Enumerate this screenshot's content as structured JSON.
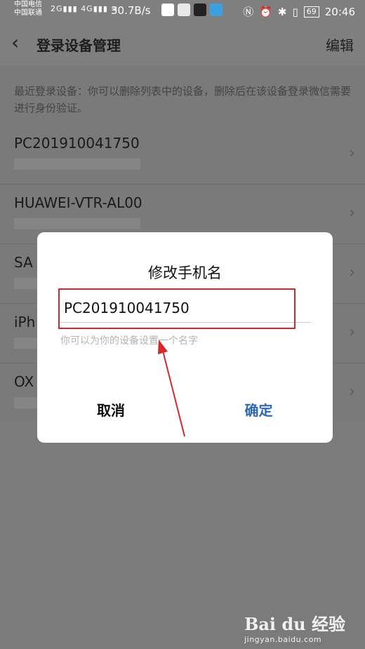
{
  "status": {
    "carrier1": "中国电信",
    "carrier2": "中国联通",
    "net1": "2G",
    "net2": "4G",
    "speed": "30.7B/s",
    "battery": "69",
    "time": "20:46",
    "icons": [
      "cloud-app-icon",
      "video-app-icon",
      "tiktok-icon",
      "paper-plane-icon",
      "nfc-icon",
      "alarm-icon",
      "bluetooth-icon",
      "vibrate-icon"
    ]
  },
  "header": {
    "back_icon": "chevron-left-icon",
    "title": "登录设备管理",
    "edit_label": "编辑"
  },
  "hint": "最近登录设备：你可以删除列表中的设备，删除后在该设备登录微信需要进行身份验证。",
  "devices": [
    {
      "name": "PC201910041750"
    },
    {
      "name": "HUAWEI-VTR-AL00"
    },
    {
      "name": "SA"
    },
    {
      "name": "iPh"
    },
    {
      "name": "OX"
    }
  ],
  "dialog": {
    "title": "修改手机名",
    "input_value": "PC201910041750",
    "hint": "你可以为你的设备设置一个名字",
    "cancel_label": "取消",
    "ok_label": "确定"
  },
  "colors": {
    "accent": "#2d67b8",
    "highlight": "#d5282a"
  },
  "watermark": {
    "main": "Bai du 经验",
    "sub": "jingyan.baidu.com"
  }
}
